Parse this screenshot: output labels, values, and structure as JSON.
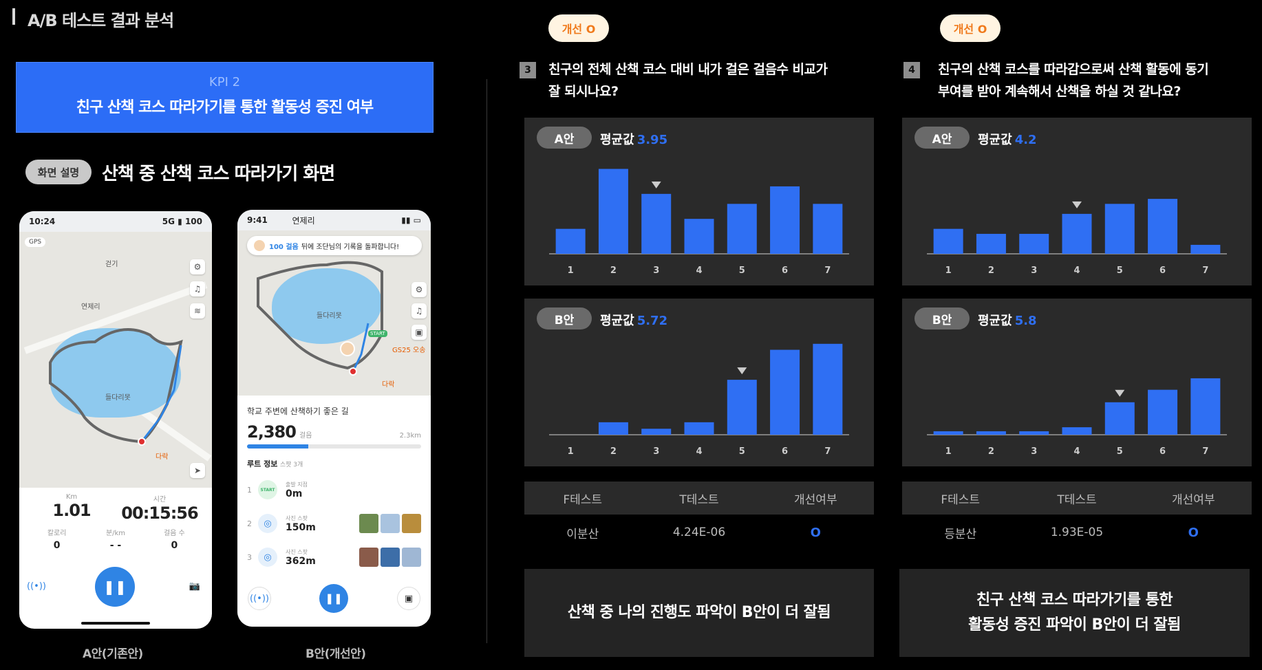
{
  "title": "A/B 테스트 결과 분석",
  "kpi": {
    "label": "KPI 2",
    "text": "친구 산책 코스 따라가기를 통한 활동성 증진 여부"
  },
  "screen": {
    "pill": "화면 설명",
    "title": "산책 중 산책 코스 따라가기 화면"
  },
  "phone_a": {
    "time": "10:24",
    "signal": "5G",
    "battery": "100",
    "gps": "GPS",
    "map_labels": [
      "걷기",
      "연제리",
      "들다리못",
      "다락"
    ],
    "stats": {
      "km_label": "Km",
      "km_value": "1.01",
      "time_label": "시간",
      "time_value": "00:15:56",
      "cal_label": "칼로리",
      "cal_value": "0",
      "pace_label": "분/km",
      "pace_value": "- -",
      "steps_label": "걸음 수",
      "steps_value": "0"
    },
    "caption": "A안(기존안)"
  },
  "phone_b": {
    "time": "9:41",
    "location": "연제리",
    "banner_steps": "100 걸음",
    "banner_text": "뒤에 조단님의 기록을 돌파합니다!",
    "map_labels": [
      "들다리못",
      "GS25 오송",
      "다락",
      "START"
    ],
    "route_title": "학교 주변에 산책하기 좋은 길",
    "steps": "2,380",
    "steps_unit": "걸음",
    "distance": "2.3km",
    "progress": 0.35,
    "route_info_label": "루트 정보",
    "route_info_sub": "스팟 3개",
    "route_items": [
      {
        "num": "1",
        "badge": "START",
        "sub": "출발 지점",
        "dist": "0m"
      },
      {
        "num": "2",
        "badge": "",
        "sub": "사진 스팟",
        "dist": "150m"
      },
      {
        "num": "3",
        "badge": "",
        "sub": "사진 스팟",
        "dist": "362m"
      }
    ],
    "caption": "B안(개선안)"
  },
  "q3": {
    "badge": "개선 O",
    "num": "3",
    "line1": "친구의 전체 산책 코스 대비 내가 걸은 걸음수 비교가",
    "line2": "잘 되시나요?",
    "a_pill": "A안",
    "a_avg_label": "평균값",
    "a_avg": "3.95",
    "b_pill": "B안",
    "b_avg_label": "평균값",
    "b_avg": "5.72",
    "table": {
      "h1": "F테스트",
      "h2": "T테스트",
      "h3": "개선여부",
      "v1": "이분산",
      "v2": "4.24E-06",
      "v3": "O"
    },
    "conclusion": "산책 중 나의 진행도 파악이 B안이 더 잘됨"
  },
  "q4": {
    "badge": "개선 O",
    "num": "4",
    "line1": "친구의 산책 코스를 따라감으로써 산책 활동에 동기",
    "line2": "부여를 받아 계속해서 산책을 하실 것 같나요?",
    "a_pill": "A안",
    "a_avg_label": "평균값",
    "a_avg": "4.2",
    "b_pill": "B안",
    "b_avg_label": "평균값",
    "b_avg": "5.8",
    "table": {
      "h1": "F테스트",
      "h2": "T테스트",
      "h3": "개선여부",
      "v1": "등분산",
      "v2": "1.93E-05",
      "v3": "O"
    },
    "conclusion_line1": "친구 산책 코스 따라가기를 통한",
    "conclusion_line2": "활동성 증진 파악이 B안이 더 잘됨"
  },
  "chart_data": [
    {
      "type": "bar",
      "name": "Q3 A안",
      "categories": [
        "1",
        "2",
        "3",
        "4",
        "5",
        "6",
        "7"
      ],
      "values": [
        5,
        17,
        12,
        7,
        10,
        13.5,
        10
      ],
      "mean_marker_category": "3",
      "color": "#2f6ff3"
    },
    {
      "type": "bar",
      "name": "Q3 B안",
      "categories": [
        "1",
        "2",
        "3",
        "4",
        "5",
        "6",
        "7"
      ],
      "values": [
        0,
        2.5,
        1.2,
        2.5,
        11,
        17,
        18.2
      ],
      "mean_marker_category": "5",
      "color": "#2f6ff3"
    },
    {
      "type": "bar",
      "name": "Q4 A안",
      "categories": [
        "1",
        "2",
        "3",
        "4",
        "5",
        "6",
        "7"
      ],
      "values": [
        5,
        4,
        4,
        8,
        10,
        11,
        1.8
      ],
      "mean_marker_category": "4",
      "color": "#2f6ff3"
    },
    {
      "type": "bar",
      "name": "Q4 B안",
      "categories": [
        "1",
        "2",
        "3",
        "4",
        "5",
        "6",
        "7"
      ],
      "values": [
        0.7,
        0.7,
        0.7,
        1.5,
        6.5,
        9,
        11.3
      ],
      "mean_marker_category": "5",
      "color": "#2f6ff3"
    }
  ]
}
